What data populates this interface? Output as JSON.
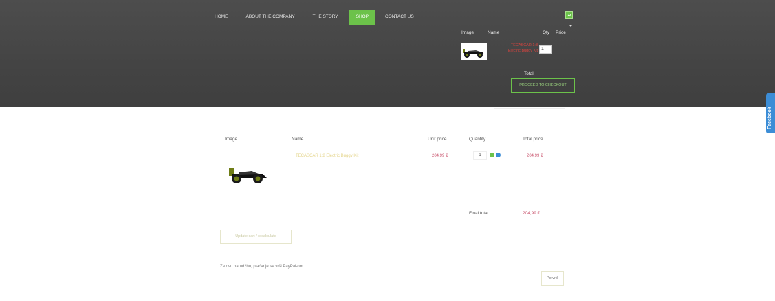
{
  "nav": {
    "items": [
      {
        "label": "HOME"
      },
      {
        "label": "ABOUT THE COMPANY"
      },
      {
        "label": "THE STORY"
      },
      {
        "label": "SHOP"
      },
      {
        "label": "CONTACT US"
      }
    ],
    "active_index": 3
  },
  "mini_cart": {
    "headers": {
      "image": "Image",
      "name": "Name",
      "qty": "Qty",
      "price": "Price"
    },
    "item": {
      "name": "TECASCAR 1:8 Electric Buggy Kit",
      "qty": "1"
    },
    "total_label": "Total",
    "checkout_label": "PROCEED TO CHECKOUT"
  },
  "facebook_tab": {
    "label": "Facebook"
  },
  "cart": {
    "headers": {
      "image": "Image",
      "name": "Name",
      "unit_price": "Unit price",
      "quantity": "Quantity",
      "total_price": "Total price"
    },
    "rows": [
      {
        "name": "TECASCAR 1:8 Electric Buggy Kit",
        "unit_price": "204,99 €",
        "quantity": "1",
        "total_price": "204,99 €"
      }
    ],
    "final_total_label": "Final total",
    "final_total_value": "204,99 €"
  },
  "actions": {
    "update_label": "Update cart / recalculate",
    "submit_label": "Potvrdi"
  },
  "payment_text": "Za ovu narudžbu, plaćanje se vrši PayPal-om",
  "colors": {
    "accent": "#6cc24a",
    "price": "#c8506a",
    "header_bg": "#474747",
    "facebook": "#3c8dd6"
  }
}
